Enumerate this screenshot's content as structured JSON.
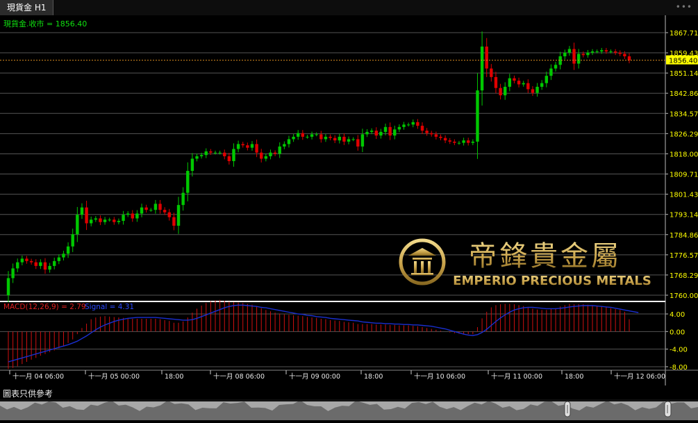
{
  "tab": {
    "title": "現貨金 H1"
  },
  "price_label": "現貨金.收市 = 1856.40",
  "current_price": "1856.40",
  "macd_label": "MACD(12,26,9) = 2.79",
  "signal_label": "Signal = 4.31",
  "footer_note": "圖表只供參考",
  "watermark": {
    "chinese": "帝鋒貴金屬",
    "english": "EMPERIO PRECIOUS METALS"
  },
  "colors": {
    "up": "#00c800",
    "down": "#e00000",
    "signal": "#1a2fd0",
    "macd_hist": "#d01010",
    "price_text": "#ffff00",
    "last_line": "#e09020",
    "gold": "#c8a24a"
  },
  "chart_data": {
    "type": "candlestick",
    "title": "現貨金 H1",
    "price_axis": {
      "ticks": [
        1867.71,
        1859.43,
        1851.14,
        1842.86,
        1834.57,
        1826.29,
        1818.0,
        1809.71,
        1801.43,
        1793.14,
        1784.86,
        1776.57,
        1768.29,
        1760.0
      ],
      "ylim": [
        1760.0,
        1867.71
      ]
    },
    "macd_axis": {
      "ticks": [
        4.0,
        0.0,
        -4.0,
        -8.0
      ]
    },
    "time_labels": [
      "十一月 04 06:00",
      "十一月 05 00:00",
      "18:00",
      "十一月 08 06:00",
      "十一月 09 00:00",
      "18:00",
      "十一月 10 06:00",
      "十一月 11 00:00",
      "18:00",
      "十一月 12 06:00"
    ],
    "close_series": [
      1767.0,
      1771.0,
      1773.5,
      1775.0,
      1774.0,
      1773.5,
      1772.0,
      1773.5,
      1770.5,
      1772.0,
      1774.0,
      1775.5,
      1777.0,
      1780.0,
      1785.0,
      1793.0,
      1796.0,
      1789.5,
      1791.0,
      1791.5,
      1790.0,
      1791.0,
      1791.0,
      1790.0,
      1790.5,
      1793.0,
      1793.5,
      1791.5,
      1793.5,
      1796.0,
      1795.0,
      1795.0,
      1797.5,
      1795.0,
      1794.0,
      1792.0,
      1788.5,
      1797.0,
      1802.0,
      1811.0,
      1816.0,
      1817.0,
      1817.5,
      1819.0,
      1818.5,
      1818.5,
      1818.5,
      1817.0,
      1815.0,
      1820.0,
      1822.0,
      1821.5,
      1820.5,
      1822.0,
      1818.5,
      1816.0,
      1817.0,
      1818.5,
      1818.0,
      1821.0,
      1822.0,
      1824.0,
      1825.0,
      1826.5,
      1825.0,
      1825.0,
      1826.0,
      1826.0,
      1824.0,
      1825.0,
      1824.5,
      1823.5,
      1825.0,
      1823.0,
      1824.0,
      1824.0,
      1821.0,
      1826.0,
      1827.0,
      1827.5,
      1825.5,
      1827.0,
      1829.0,
      1825.5,
      1828.0,
      1829.0,
      1830.0,
      1830.0,
      1831.0,
      1829.5,
      1827.5,
      1826.5,
      1826.0,
      1825.0,
      1824.5,
      1823.5,
      1823.0,
      1822.5,
      1822.5,
      1823.5,
      1822.5,
      1823.0,
      1844.0,
      1862.0,
      1853.0,
      1849.5,
      1845.0,
      1842.0,
      1845.5,
      1849.0,
      1848.0,
      1846.5,
      1847.0,
      1844.5,
      1843.0,
      1845.5,
      1847.0,
      1850.0,
      1853.0,
      1854.5,
      1858.0,
      1859.5,
      1861.0,
      1855.0,
      1859.0,
      1858.5,
      1859.5,
      1860.0,
      1860.0,
      1860.5,
      1860.0,
      1860.0,
      1859.5,
      1859.0,
      1858.0,
      1856.4
    ],
    "macd_series": [
      -8.5,
      -8.3,
      -7.9,
      -7.4,
      -6.9,
      -6.4,
      -6.0,
      -5.5,
      -5.1,
      -4.7,
      -4.3,
      -3.8,
      -3.3,
      -2.6,
      -1.8,
      -0.6,
      0.8,
      1.8,
      2.8,
      3.2,
      3.4,
      3.5,
      3.4,
      3.3,
      3.2,
      3.1,
      3.0,
      2.9,
      2.9,
      2.9,
      2.9,
      2.9,
      2.9,
      2.8,
      2.6,
      2.4,
      2.0,
      2.0,
      2.3,
      3.2,
      4.3,
      5.2,
      5.9,
      6.5,
      6.9,
      7.1,
      7.2,
      7.0,
      6.8,
      6.7,
      6.6,
      6.5,
      6.3,
      6.1,
      5.7,
      5.3,
      4.9,
      4.6,
      4.3,
      4.1,
      3.9,
      3.8,
      3.7,
      3.6,
      3.5,
      3.3,
      3.2,
      3.1,
      2.9,
      2.8,
      2.6,
      2.5,
      2.4,
      2.2,
      2.1,
      2.0,
      1.7,
      1.7,
      1.7,
      1.7,
      1.6,
      1.6,
      1.6,
      1.5,
      1.5,
      1.4,
      1.4,
      1.4,
      1.3,
      1.2,
      1.0,
      0.8,
      0.6,
      0.4,
      0.2,
      0.0,
      -0.2,
      -0.4,
      -0.5,
      -0.5,
      -0.6,
      -0.6,
      1.0,
      3.0,
      4.5,
      5.5,
      6.0,
      6.2,
      6.3,
      6.3,
      6.2,
      6.0,
      5.8,
      5.5,
      5.2,
      5.0,
      4.9,
      4.9,
      5.1,
      5.3,
      5.7,
      6.0,
      6.3,
      6.2,
      6.2,
      6.2,
      6.1,
      6.0,
      5.8,
      5.7,
      5.5,
      5.3,
      5.1,
      4.9,
      4.5,
      2.79
    ],
    "signal_series": [
      -6.9,
      -6.6,
      -6.3,
      -6.0,
      -5.7,
      -5.4,
      -5.1,
      -4.8,
      -4.5,
      -4.2,
      -3.9,
      -3.6,
      -3.3,
      -3.0,
      -2.6,
      -2.2,
      -1.6,
      -1.0,
      -0.3,
      0.4,
      1.0,
      1.5,
      1.9,
      2.3,
      2.6,
      2.8,
      3.0,
      3.1,
      3.2,
      3.2,
      3.2,
      3.2,
      3.2,
      3.1,
      3.0,
      2.9,
      2.8,
      2.7,
      2.6,
      2.6,
      2.7,
      3.0,
      3.4,
      3.8,
      4.2,
      4.6,
      5.0,
      5.4,
      5.7,
      5.9,
      6.0,
      6.0,
      5.9,
      5.8,
      5.7,
      5.5,
      5.4,
      5.2,
      5.0,
      4.8,
      4.6,
      4.4,
      4.2,
      4.0,
      3.9,
      3.7,
      3.6,
      3.4,
      3.3,
      3.2,
      3.0,
      2.9,
      2.8,
      2.7,
      2.6,
      2.5,
      2.4,
      2.2,
      2.1,
      2.0,
      1.9,
      1.9,
      1.8,
      1.8,
      1.7,
      1.7,
      1.6,
      1.6,
      1.5,
      1.5,
      1.4,
      1.3,
      1.2,
      1.0,
      0.8,
      0.6,
      0.3,
      0.0,
      -0.3,
      -0.6,
      -0.8,
      -0.9,
      -0.7,
      -0.2,
      0.5,
      1.4,
      2.3,
      3.1,
      3.8,
      4.4,
      4.9,
      5.2,
      5.4,
      5.5,
      5.5,
      5.4,
      5.3,
      5.2,
      5.2,
      5.2,
      5.3,
      5.4,
      5.6,
      5.7,
      5.8,
      5.9,
      5.9,
      5.9,
      5.8,
      5.7,
      5.6,
      5.5,
      5.3,
      5.1,
      4.9,
      4.7,
      4.5,
      4.31
    ]
  }
}
